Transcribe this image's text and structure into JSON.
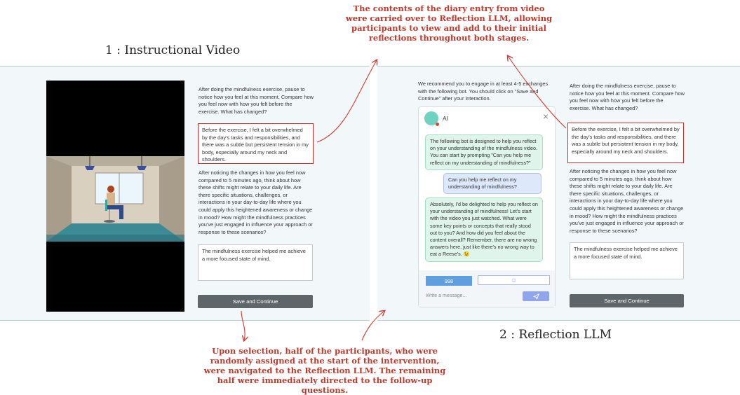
{
  "annotations": {
    "top": "The contents of the diary entry from video were carried over to Reflection LLM, allowing participants to view and add to their initial reflections throughout both stages.",
    "bottom": "Upon selection, half of the participants, who were randomly assigned at the start of the intervention, were navigated to the Reflection LLM. The remaining half were immediately directed to the follow-up questions."
  },
  "stage1": {
    "title": "1 : Instructional Video",
    "prompt1": "After doing the mindfulness exercise, pause to notice how you feel at this moment. Compare how you feel now with how you felt before the exercise. What has changed?",
    "answer1": "Before the exercise, I felt a bit overwhelmed by the day's tasks and responsibilities, and there was a subtle but persistent tension in my body, especially around my neck and shoulders.",
    "prompt2": "After noticing the changes in how you feel now compared to 5 minutes ago, think about how these shifts might relate to your daily life. Are there specific situations, challenges, or interactions in your day-to-day life where you could apply this heightened awareness or change in mood? How might the mindfulness practices you've just engaged in influence your approach or response to these scenarios?",
    "answer2": "The mindfulness exercise helped me achieve a more focused state of mind.",
    "button": "Save and Continue"
  },
  "stage2": {
    "title": "2 : Reflection LLM",
    "intro": "We recommend you to engage in at least 4-5 exchanges with the following bot. You should click on \"Save and Continue\" after your interaction.",
    "chat": {
      "agent_name": "AI",
      "close": "×",
      "messages": [
        {
          "role": "bot",
          "text": "The following bot is designed to help you reflect on your understanding of the mindfulness video. You can start by prompting \"Can you help me reflect on my understanding of mindfulness?\""
        },
        {
          "role": "user",
          "text": "Can you help me reflect on my understanding of mindfulness?"
        },
        {
          "role": "bot",
          "text": "Absolutely, I'd be delighted to help you reflect on your understanding of mindfulness! Let's start with the video you just watched. What were some key points or concepts that really stood out to you? And how did you feel about the content overall? Remember, there are no wrong answers here, just like there's no wrong way to eat a Reese's. 😉"
        }
      ],
      "counter": "998",
      "emoji": "☺",
      "input_placeholder": "Write a message...",
      "send_icon": "send-icon"
    },
    "prompt1": "After doing the mindfulness exercise, pause to notice how you feel at this moment. Compare how you feel now with how you felt before the exercise. What has changed?",
    "answer1": "Before the exercise, I felt a bit overwhelmed by the day's tasks and responsibilities, and there was a subtle but persistent tension in my body, especially around my neck and shoulders.",
    "prompt2": "After noticing the changes in how you feel now compared to 5 minutes ago, think about how these shifts might relate to your daily life. Are there specific situations, challenges, or interactions in your day-to-day life where you could apply this heightened awareness or change in mood? How might the mindfulness practices you've just engaged in influence your approach or response to these scenarios?",
    "answer2": "The mindfulness exercise helped me achieve a more focused state of mind.",
    "button": "Save and Continue"
  },
  "colors": {
    "annotation": "#c0392b",
    "highlight_border": "#cc2b2b",
    "button": "#5f6669",
    "send": "#8fa6ee",
    "counter": "#5f9ee0"
  }
}
